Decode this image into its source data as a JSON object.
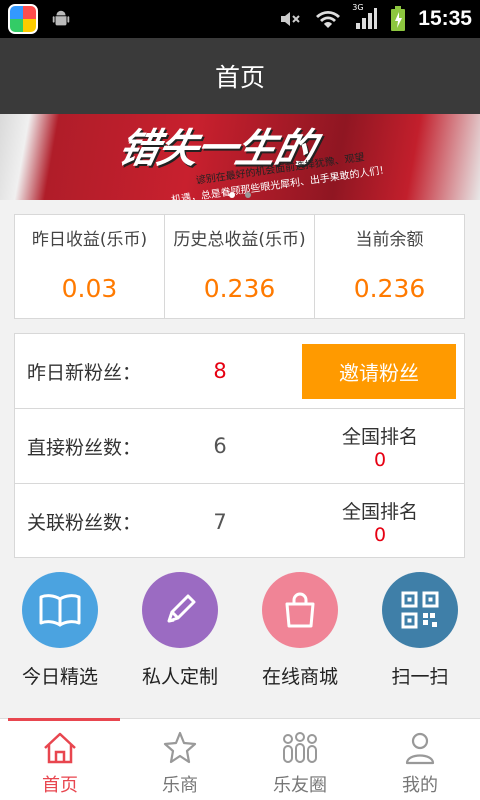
{
  "status_bar": {
    "time": "15:35",
    "network_badge": "3G",
    "icons": [
      "app-store-icon",
      "android-debug-icon",
      "mute-icon",
      "wifi-icon",
      "signal-icon",
      "battery-charging-icon"
    ]
  },
  "header": {
    "title": "首页"
  },
  "banner": {
    "headline": "错失一生的",
    "line1": "谚别在最好的机会面前选择犹豫、观望",
    "line2": "机遇，总是眷顾那些眼光犀利、出手果敢的人们！",
    "slide_count": 2,
    "active_slide": 1
  },
  "stats": [
    {
      "label": "昨日收益(乐币)",
      "value": "0.03"
    },
    {
      "label": "历史总收益(乐币)",
      "value": "0.236"
    },
    {
      "label": "当前余额",
      "value": "0.236"
    }
  ],
  "fans": {
    "yesterday_new_label": "昨日新粉丝：",
    "yesterday_new_value": "8",
    "invite_label": "邀请粉丝",
    "direct_label": "直接粉丝数：",
    "direct_value": "6",
    "direct_rank_label": "全国排名",
    "direct_rank_value": "0",
    "related_label": "关联粉丝数：",
    "related_value": "7",
    "related_rank_label": "全国排名",
    "related_rank_value": "0"
  },
  "actions": [
    {
      "label": "今日精选",
      "icon": "open-book-icon",
      "color": "#4ba3e0"
    },
    {
      "label": "私人定制",
      "icon": "pencil-icon",
      "color": "#9b6bc2"
    },
    {
      "label": "在线商城",
      "icon": "shopping-bag-icon",
      "color": "#f08496"
    },
    {
      "label": "扫一扫",
      "icon": "qr-code-icon",
      "color": "#3f7fa8"
    }
  ],
  "tabs": [
    {
      "label": "首页",
      "icon": "home-icon",
      "active": true
    },
    {
      "label": "乐商",
      "icon": "star-icon",
      "active": false
    },
    {
      "label": "乐友圈",
      "icon": "group-icon",
      "active": false
    },
    {
      "label": "我的",
      "icon": "user-icon",
      "active": false
    }
  ],
  "colors": {
    "accent_orange": "#ff9a00",
    "value_orange": "#ff7a00",
    "alert_red": "#e60012",
    "tab_active": "#e8464f",
    "title_bar": "#3a3a3a"
  }
}
